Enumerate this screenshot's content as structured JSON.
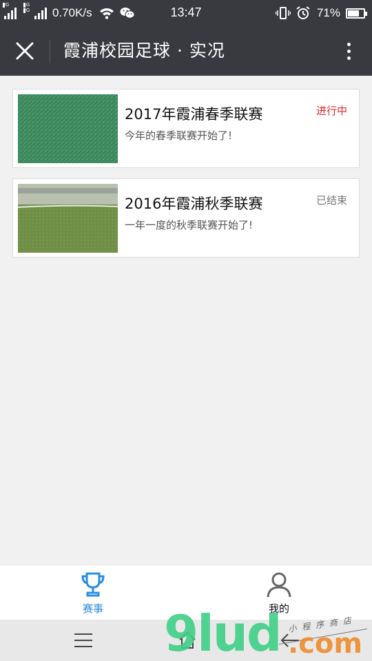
{
  "status_bar": {
    "network_1": "2G",
    "network_2": "4G",
    "network_3": "2G",
    "speed": "0.70K/s",
    "time": "13:47",
    "battery_percent": "71%",
    "battery_level": 0.71
  },
  "title_bar": {
    "title": "霞浦校园足球 · 实况"
  },
  "matches": [
    {
      "title": "2017年霞浦春季联赛",
      "description": "今年的春季联赛开始了!",
      "status": "进行中"
    },
    {
      "title": "2016年霞浦秋季联赛",
      "description": "一年一度的秋季联赛开始了!",
      "status": "已结束"
    }
  ],
  "tab_bar": {
    "tabs": [
      {
        "label": "赛事"
      },
      {
        "label": "我的"
      }
    ],
    "active_color": "#2a8de0"
  },
  "colors": {
    "header": "#393a3f",
    "status_live": "#e02a2a",
    "status_done": "#777777"
  },
  "watermark": {
    "main": "9lud",
    "domain": ".com",
    "sub": "小程序商店"
  }
}
